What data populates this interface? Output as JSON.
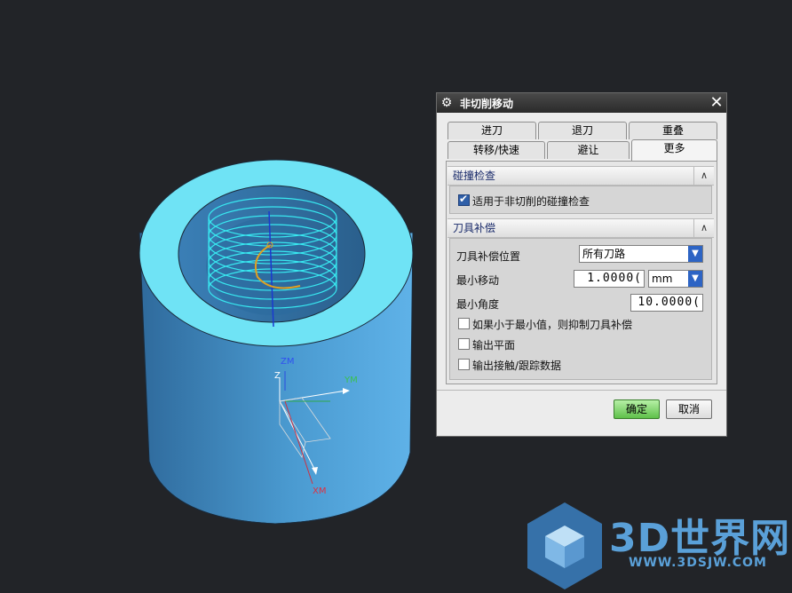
{
  "dialog": {
    "title": "非切削移动",
    "close_symbol": "✕",
    "tabs_row1": [
      "进刀",
      "退刀",
      "重叠"
    ],
    "tabs_row2": [
      "转移/快速",
      "避让",
      "更多"
    ],
    "active_tab": "更多",
    "collision": {
      "header": "碰撞检查",
      "checkbox_label": "适用于非切削的碰撞检查",
      "checked": true
    },
    "cutter_comp": {
      "header": "刀具补偿",
      "position_label": "刀具补偿位置",
      "position_value": "所有刀路",
      "min_move_label": "最小移动",
      "min_move_value": "1.0000(",
      "min_move_unit": "mm",
      "min_angle_label": "最小角度",
      "min_angle_value": "10.0000(",
      "suppress_label": "如果小于最小值，则抑制刀具补偿",
      "output_plane_label": "输出平面",
      "output_contact_label": "输出接触/跟踪数据"
    },
    "ok_label": "确定",
    "cancel_label": "取消"
  },
  "viewport": {
    "axis_labels": {
      "zm": "ZM",
      "z": "Z",
      "ym": "YM",
      "xm": "XM"
    },
    "colors": {
      "background": "#222428",
      "part": "#4a9ad0",
      "top": "#6fe3f5",
      "toolpath": "#38e8f0",
      "arc": "#e0a020"
    }
  },
  "watermark": {
    "text": "3D世界网",
    "url": "WWW.3DSJW.COM"
  }
}
